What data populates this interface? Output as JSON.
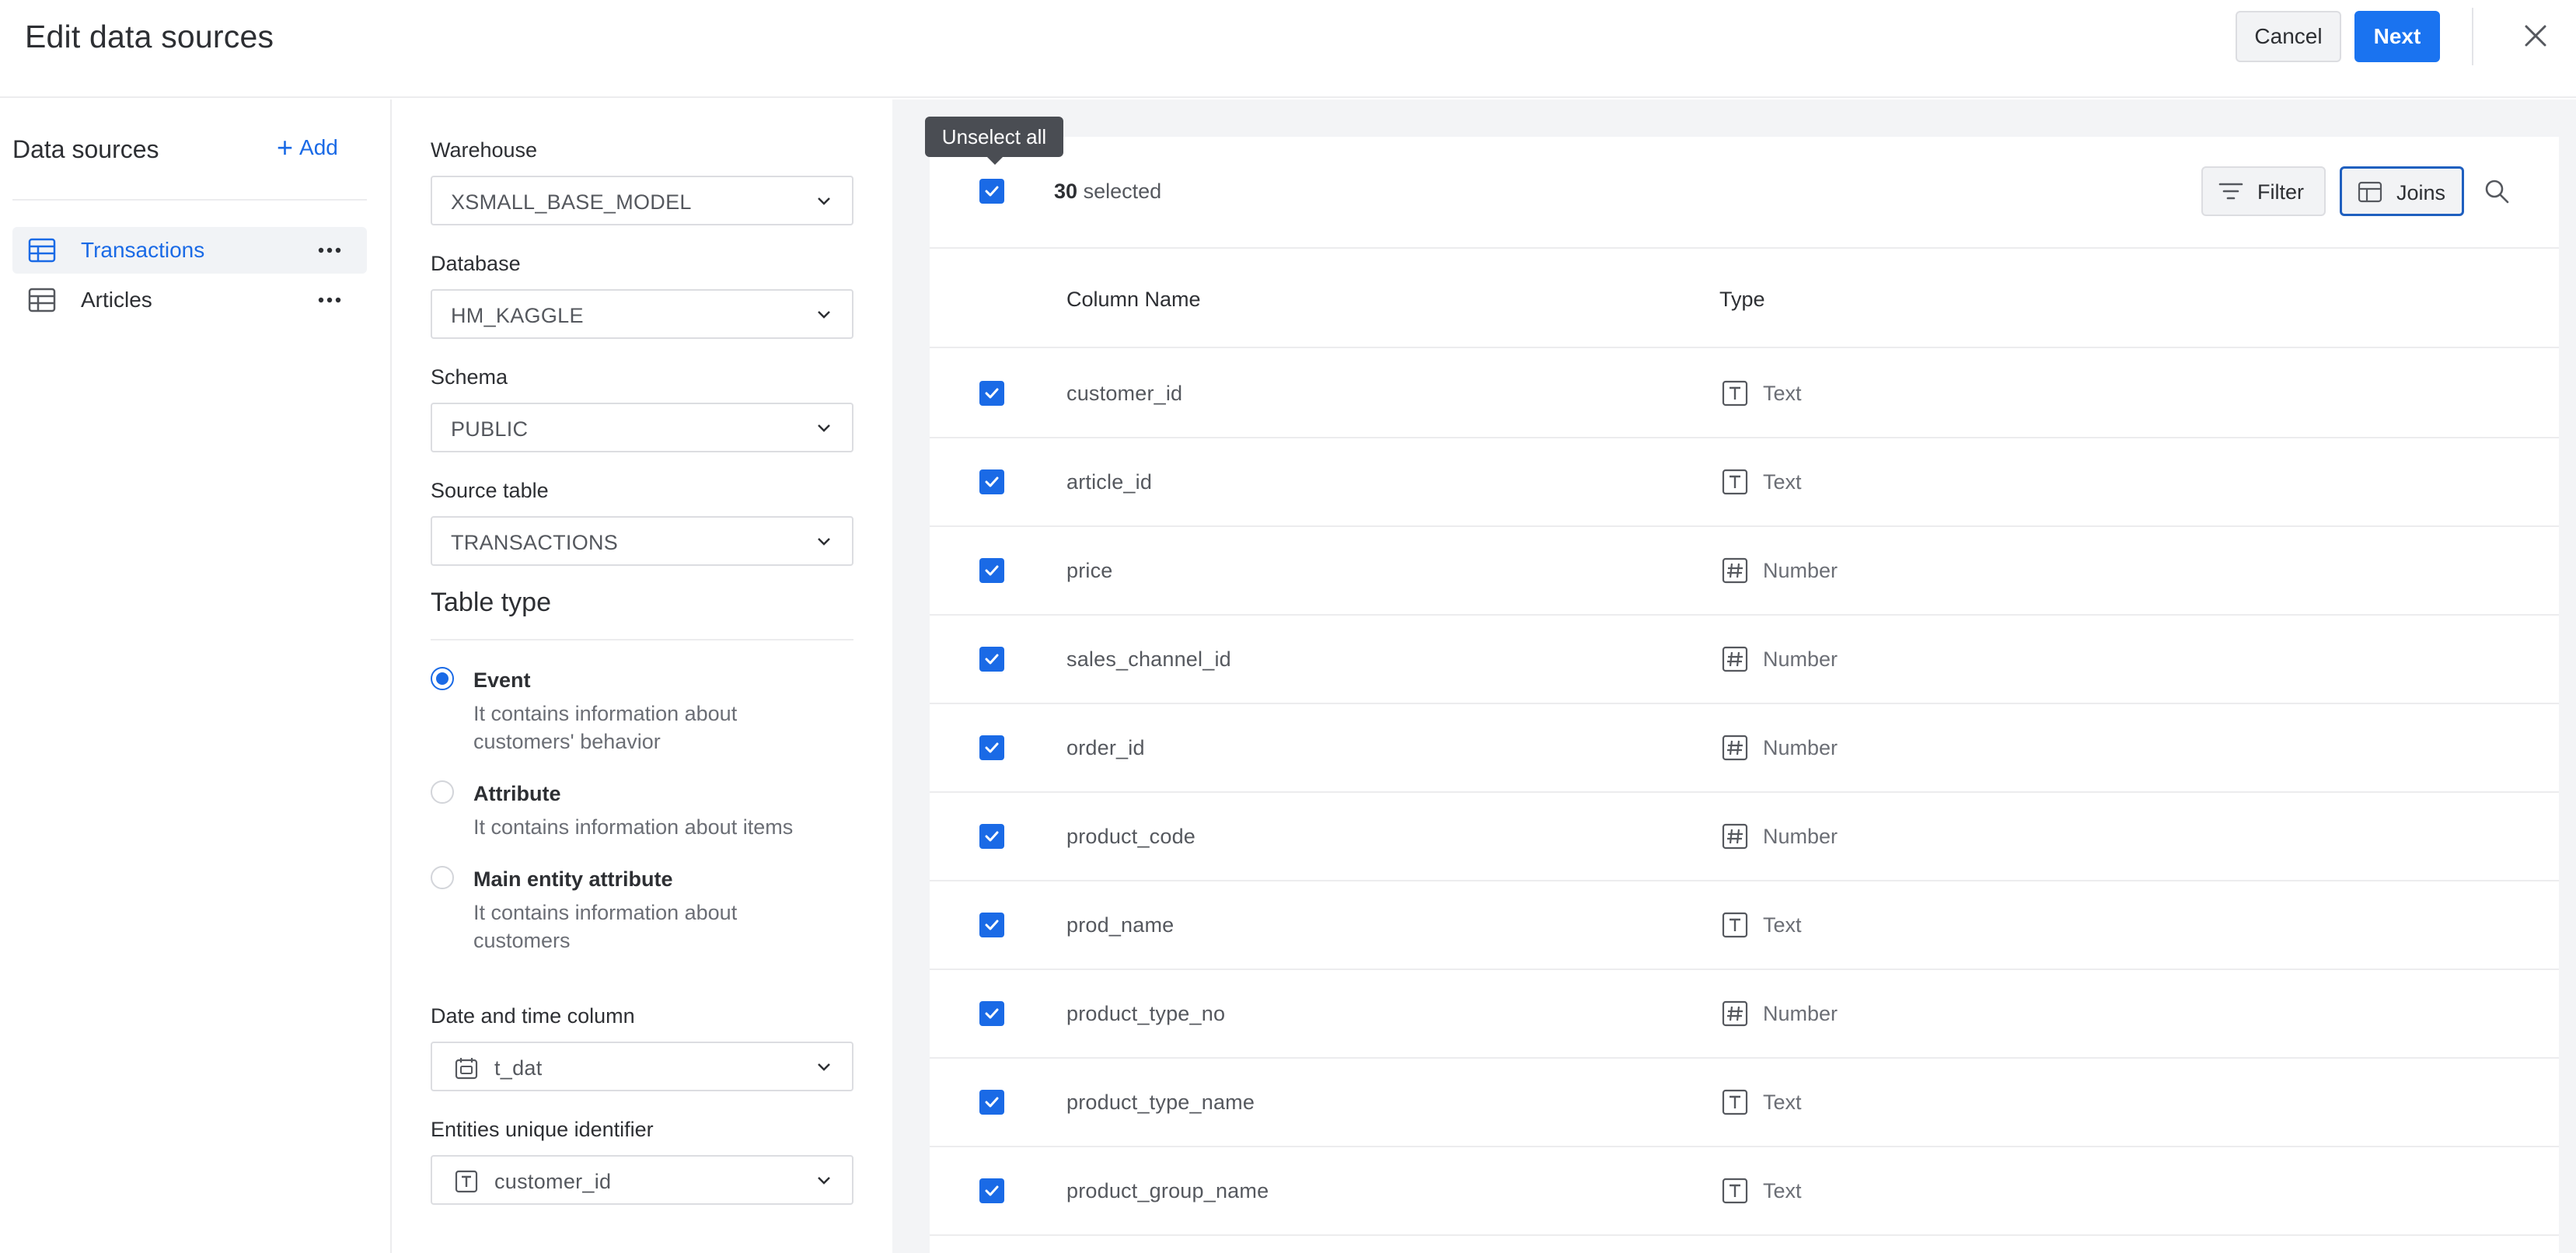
{
  "header": {
    "title": "Edit data sources",
    "cancel_label": "Cancel",
    "next_label": "Next"
  },
  "sidebar": {
    "title": "Data sources",
    "add_label": "Add",
    "items": [
      {
        "label": "Transactions",
        "active": true
      },
      {
        "label": "Articles",
        "active": false
      }
    ]
  },
  "form": {
    "warehouse": {
      "label": "Warehouse",
      "value": "XSMALL_BASE_MODEL"
    },
    "database": {
      "label": "Database",
      "value": "HM_KAGGLE"
    },
    "schema": {
      "label": "Schema",
      "value": "PUBLIC"
    },
    "source_table": {
      "label": "Source table",
      "value": "TRANSACTIONS"
    },
    "table_type": {
      "title": "Table type",
      "options": [
        {
          "label": "Event",
          "desc": "It contains information about customers' behavior",
          "checked": true
        },
        {
          "label": "Attribute",
          "desc": "It contains information about items",
          "checked": false
        },
        {
          "label": "Main entity attribute",
          "desc": "It contains information about customers",
          "checked": false
        }
      ]
    },
    "date_column": {
      "label": "Date and time column",
      "value": "t_dat"
    },
    "entity_id": {
      "label": "Entities unique identifier",
      "value": "customer_id"
    }
  },
  "columns_panel": {
    "tooltip": "Unselect all",
    "selected_count": "30",
    "selected_suffix": "selected",
    "filter_label": "Filter",
    "joins_label": "Joins",
    "headers": {
      "name": "Column Name",
      "type": "Type"
    },
    "rows": [
      {
        "name": "customer_id",
        "type": "Text",
        "icon": "text-type-icon"
      },
      {
        "name": "article_id",
        "type": "Text",
        "icon": "text-type-icon"
      },
      {
        "name": "price",
        "type": "Number",
        "icon": "number-type-icon"
      },
      {
        "name": "sales_channel_id",
        "type": "Number",
        "icon": "number-type-icon"
      },
      {
        "name": "order_id",
        "type": "Number",
        "icon": "number-type-icon"
      },
      {
        "name": "product_code",
        "type": "Number",
        "icon": "number-type-icon"
      },
      {
        "name": "prod_name",
        "type": "Text",
        "icon": "text-type-icon"
      },
      {
        "name": "product_type_no",
        "type": "Number",
        "icon": "number-type-icon"
      },
      {
        "name": "product_type_name",
        "type": "Text",
        "icon": "text-type-icon"
      },
      {
        "name": "product_group_name",
        "type": "Text",
        "icon": "text-type-icon"
      }
    ]
  },
  "colors": {
    "accent": "#1a73f0",
    "link": "#1a6ae6",
    "panel_bg": "#f3f4f6"
  }
}
